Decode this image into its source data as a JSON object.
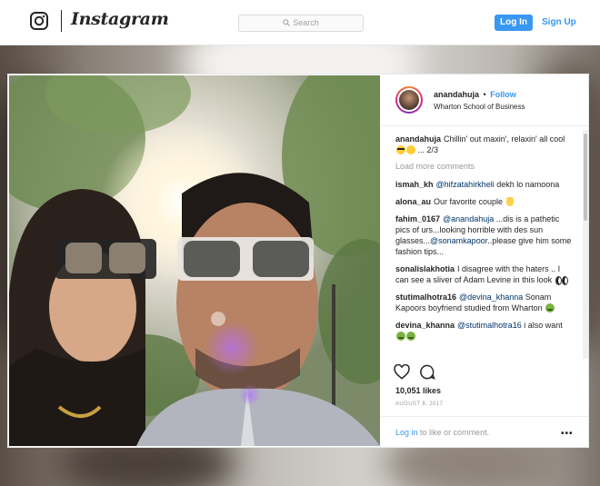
{
  "header": {
    "brand": "Instagram",
    "search_placeholder": "Search",
    "login_label": "Log In",
    "signup_label": "Sign Up"
  },
  "post": {
    "username": "anandahuja",
    "separator": "•",
    "follow_label": "Follow",
    "location": "Wharton School of Business",
    "caption": {
      "user": "anandahuja",
      "text": "Chillin' out maxin', relaxin' all cool",
      "suffix": "... 2/3"
    },
    "load_more": "Load more comments",
    "comments": [
      {
        "user": "ismah_kh",
        "mention": "@hifzatahirkheli",
        "text": "dekh lo namoona"
      },
      {
        "user": "alona_au",
        "text": "Our favorite couple"
      },
      {
        "user": "fahim_0167",
        "mention": "@anandahuja",
        "text": "...dis is a pathetic pics of urs...looking horrible with des sun glasses...",
        "mention2": "@sonamkapoor",
        "text2": "..please give him some fashion tips..."
      },
      {
        "user": "sonalislakhotia",
        "text": "I disagree with the haters .. I can see a sliver of Adam Levine in this look"
      },
      {
        "user": "stutimalhotra16",
        "mention": "@devina_khanna",
        "text": "Sonam Kapoors boyfriend studied from Wharton"
      },
      {
        "user": "devina_khanna",
        "mention": "@stutimalhotra16",
        "text": "i also want"
      }
    ],
    "likes": "10,051 likes",
    "date": "AUGUST 8, 2017",
    "login_prompt_link": "Log in",
    "login_prompt_text": "to like or comment.",
    "more_label": "•••"
  },
  "icons": [
    "instagram-glyph-icon",
    "search-icon",
    "heart-icon",
    "comment-icon",
    "more-options-icon",
    "sunglasses-emoji-icon",
    "grin-emoji-icon",
    "money-bag-emoji-icon",
    "eyes-emoji-icon",
    "nauseated-emoji-icon"
  ],
  "colors": {
    "accent": "#3897f0",
    "text": "#262626",
    "muted": "#999999",
    "mention": "#003569"
  }
}
